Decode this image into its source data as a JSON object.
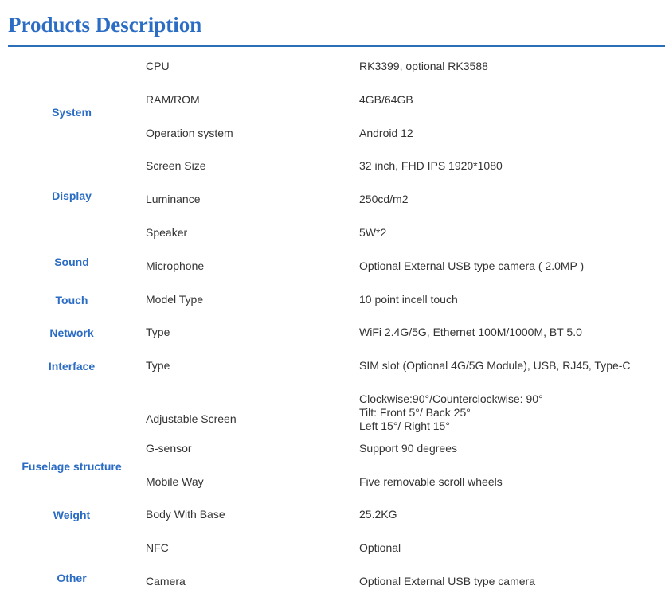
{
  "title": "Products Description",
  "groups": [
    {
      "name": "System"
    },
    {
      "name": "Display"
    },
    {
      "name": "Sound"
    },
    {
      "name": "Touch"
    },
    {
      "name": "Network"
    },
    {
      "name": "Interface"
    },
    {
      "name": "Fuselage structure"
    },
    {
      "name": "Weight"
    },
    {
      "name": "Other"
    }
  ],
  "rows": [
    {
      "label": "CPU",
      "value": "RK3399, optional RK3588"
    },
    {
      "label": "RAM/ROM",
      "value": "4GB/64GB"
    },
    {
      "label": "Operation system",
      "value": "Android 12"
    },
    {
      "label": "Screen Size",
      "value": "32 inch, FHD IPS 1920*1080"
    },
    {
      "label": "Luminance",
      "value": "250cd/m2"
    },
    {
      "label": "Speaker",
      "value": "5W*2"
    },
    {
      "label": "Microphone",
      "value": "Optional External USB type camera ( 2.0MP )"
    },
    {
      "label": "Model Type",
      "value": "10 point incell touch"
    },
    {
      "label": "Type",
      "value": "WiFi 2.4G/5G, Ethernet 100M/1000M, BT 5.0"
    },
    {
      "label": "Type",
      "value": "SIM slot (Optional 4G/5G Module), USB, RJ45, Type-C"
    },
    {
      "label": "Adjustable Screen",
      "value_lines": [
        "Clockwise:90°/Counterclockwise: 90°",
        "Tilt: Front 5°/ Back 25°",
        "Left 15°/ Right 15°"
      ]
    },
    {
      "label": "G-sensor",
      "value": "Support 90 degrees"
    },
    {
      "label": "Mobile Way",
      "value": "Five removable scroll wheels"
    },
    {
      "label": "Body With Base",
      "value": "25.2KG"
    },
    {
      "label": "NFC",
      "value": "Optional"
    },
    {
      "label": "Camera",
      "value": "Optional External USB type camera"
    }
  ]
}
